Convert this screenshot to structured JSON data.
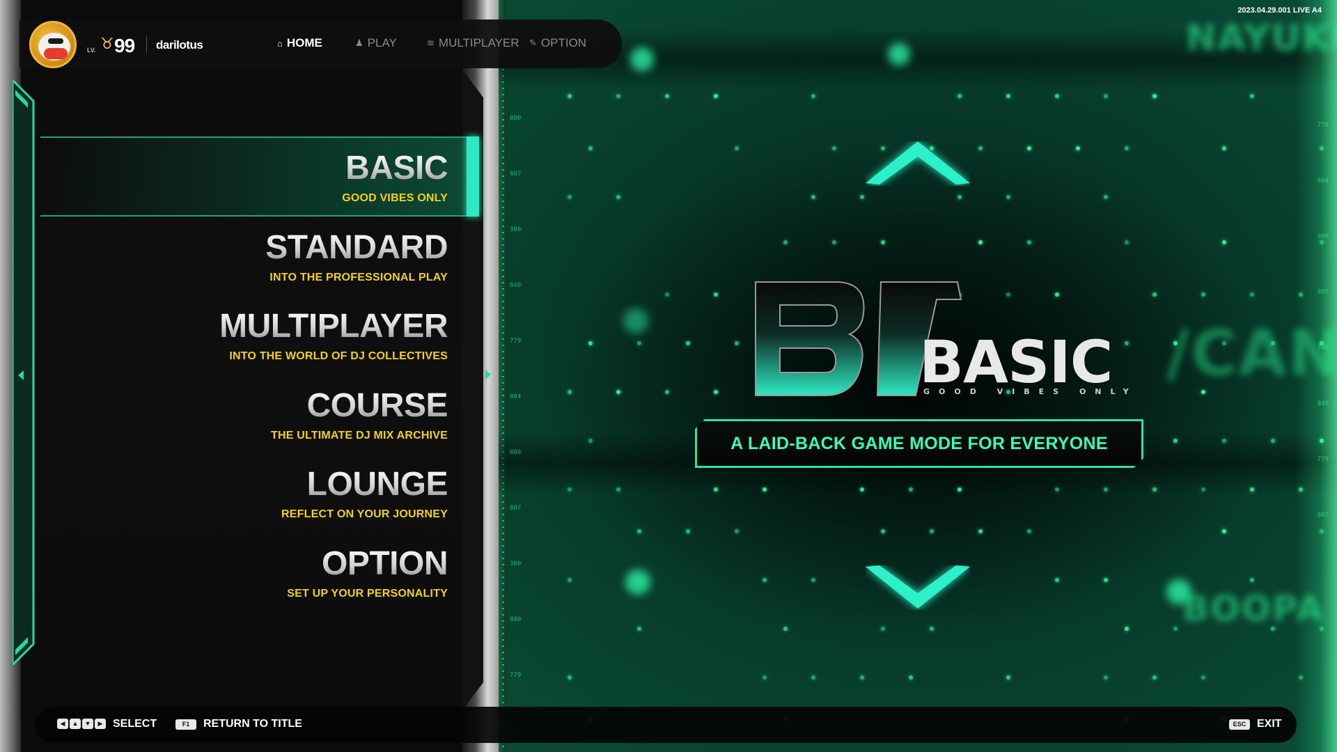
{
  "meta": {
    "build": "2023.04.29.001 LIVE A4"
  },
  "profile": {
    "level_prefix": "LV.",
    "level": "99",
    "username": "darilotus"
  },
  "nav": [
    {
      "label": "HOME",
      "icon": "home-icon",
      "glyph": "⌂",
      "active": true
    },
    {
      "label": "PLAY",
      "icon": "person-icon",
      "glyph": "♟",
      "active": false
    },
    {
      "label": "MULTIPLAYER",
      "icon": "broadcast-icon",
      "glyph": "≋",
      "active": false
    },
    {
      "label": "OPTION",
      "icon": "wrench-icon",
      "glyph": "✎",
      "active": false
    }
  ],
  "menu": [
    {
      "title": "BASIC",
      "subtitle": "GOOD VIBES ONLY",
      "selected": true
    },
    {
      "title": "STANDARD",
      "subtitle": "INTO THE PROFESSIONAL PLAY",
      "selected": false
    },
    {
      "title": "MULTIPLAYER",
      "subtitle": "INTO THE WORLD OF DJ COLLECTIVES",
      "selected": false
    },
    {
      "title": "COURSE",
      "subtitle": "THE ULTIMATE DJ MIX ARCHIVE",
      "selected": false
    },
    {
      "title": "LOUNGE",
      "subtitle": "REFLECT ON YOUR JOURNEY",
      "selected": false
    },
    {
      "title": "OPTION",
      "subtitle": "SET UP YOUR PERSONALITY",
      "selected": false
    }
  ],
  "detail": {
    "logo_mark": "B",
    "logo_title": "BASIC",
    "logo_sub": "GOOD VIBES ONLY",
    "description": "A LAID-BACK GAME MODE FOR EVERYONE"
  },
  "hints": {
    "select_keys": [
      "◀",
      "▲",
      "▼",
      "▶"
    ],
    "select_label": "SELECT",
    "title_key": "F1",
    "title_label": "RETURN TO TITLE",
    "exit_key": "ESC",
    "exit_label": "EXIT"
  },
  "colors": {
    "accent": "#2de8c0",
    "subtitle": "#f2d21c",
    "field_green": "#0a4a36"
  }
}
